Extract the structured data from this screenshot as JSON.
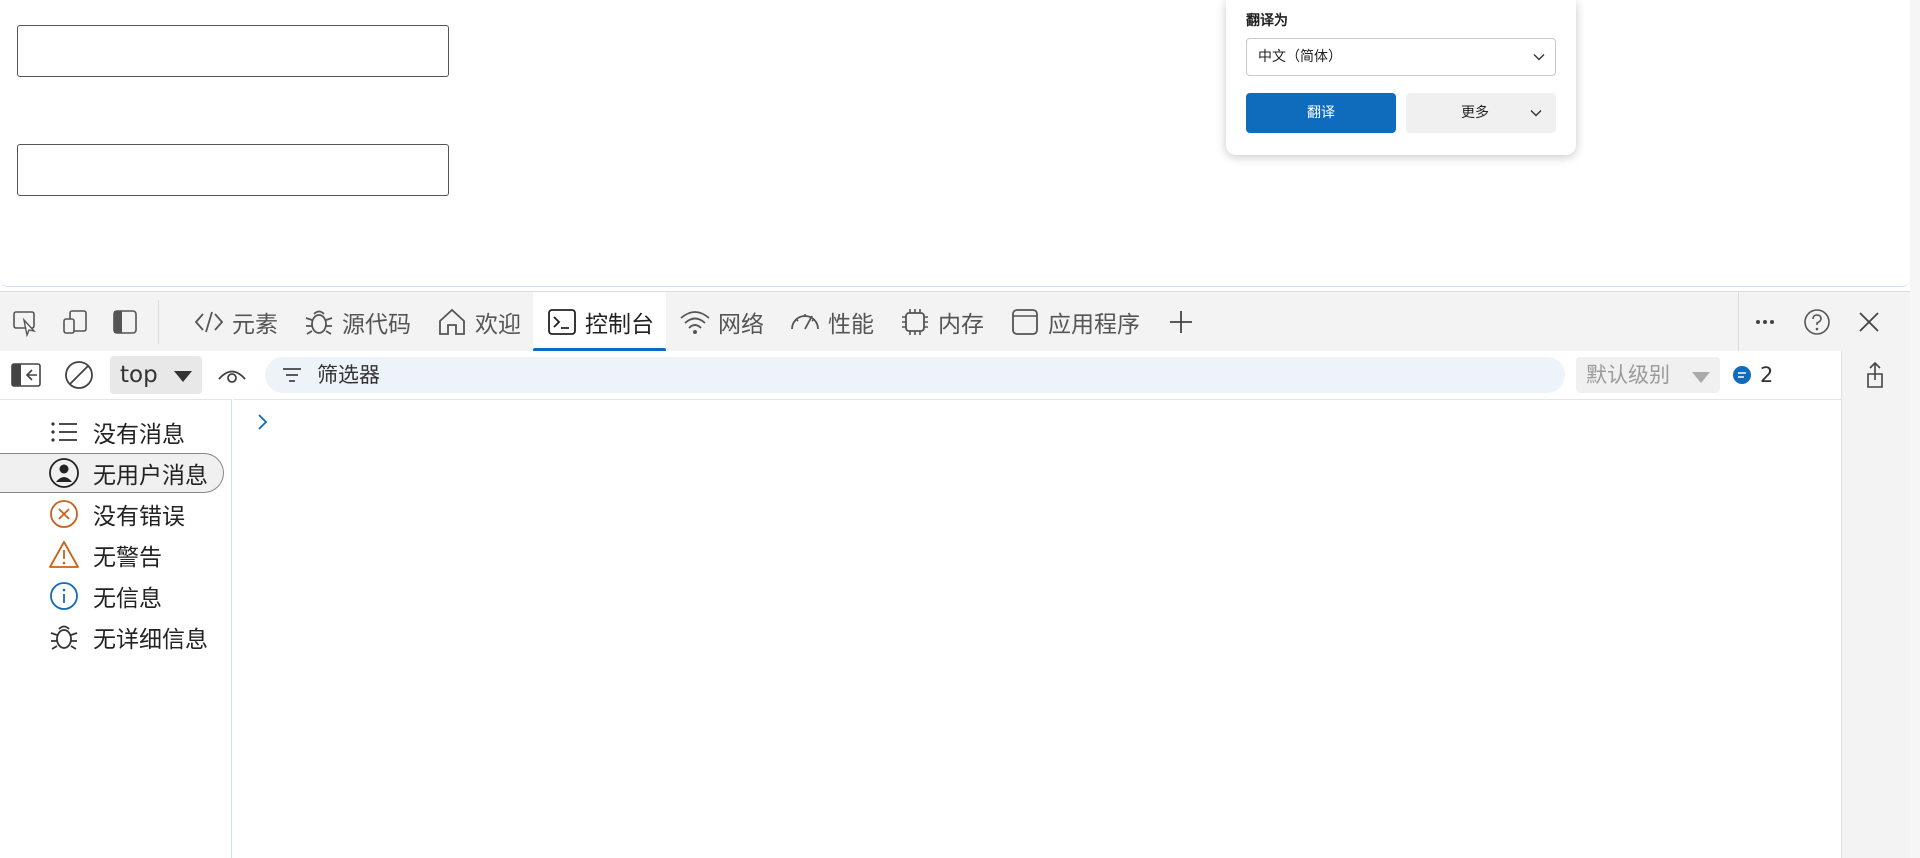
{
  "translate_popup": {
    "title": "翻译为",
    "language": "中文（简体）",
    "translate_button": "翻译",
    "more_button": "更多"
  },
  "devtools": {
    "tabs": [
      {
        "label": "元素",
        "icon": "code-icon",
        "active": false
      },
      {
        "label": "源代码",
        "icon": "bug-icon",
        "active": false
      },
      {
        "label": "欢迎",
        "icon": "home-icon",
        "active": false
      },
      {
        "label": "控制台",
        "icon": "console-icon",
        "active": true
      },
      {
        "label": "网络",
        "icon": "wifi-icon",
        "active": false
      },
      {
        "label": "性能",
        "icon": "gauge-icon",
        "active": false
      },
      {
        "label": "内存",
        "icon": "chip-icon",
        "active": false
      },
      {
        "label": "应用程序",
        "icon": "window-icon",
        "active": false
      }
    ],
    "toolbar": {
      "context": "top",
      "filter_placeholder": "筛选器",
      "level": "默认级别",
      "message_count": "2"
    },
    "sidebar": [
      {
        "label": "没有消息",
        "icon": "list-icon",
        "selected": false
      },
      {
        "label": "无用户消息",
        "icon": "user-icon",
        "selected": true
      },
      {
        "label": "没有错误",
        "icon": "error-icon",
        "selected": false
      },
      {
        "label": "无警告",
        "icon": "warning-icon",
        "selected": false
      },
      {
        "label": "无信息",
        "icon": "info-icon",
        "selected": false
      },
      {
        "label": "无详细信息",
        "icon": "bug-icon",
        "selected": false
      }
    ]
  },
  "colors": {
    "accent": "#0f6cbd",
    "error": "#c8621a",
    "warning": "#c8621a",
    "info": "#0f6cbd"
  }
}
